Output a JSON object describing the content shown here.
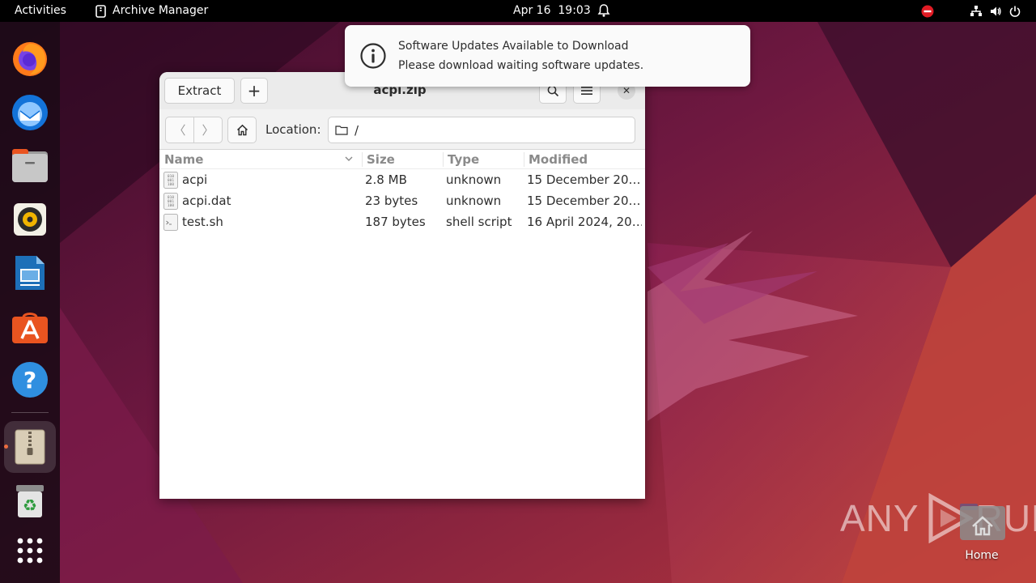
{
  "topbar": {
    "activities": "Activities",
    "app_name": "Archive Manager",
    "date": "Apr 16",
    "time": "19:03"
  },
  "dock": {
    "apps": [
      "firefox",
      "thunderbird",
      "files",
      "rhythmbox",
      "libreoffice-impress",
      "app-center",
      "help",
      "archive-manager",
      "trash",
      "show-apps"
    ]
  },
  "window": {
    "title": "acpi.zip",
    "extract_label": "Extract",
    "add_label": "+",
    "location_label": "Location:",
    "location_value": "/",
    "columns": {
      "name": "Name",
      "size": "Size",
      "type": "Type",
      "modified": "Modified"
    },
    "files": [
      {
        "icon": "binary-file-icon",
        "name": "acpi",
        "size": "2.8 MB",
        "type": "unknown",
        "modified": "15 December 20…"
      },
      {
        "icon": "binary-file-icon",
        "name": "acpi.dat",
        "size": "23 bytes",
        "type": "unknown",
        "modified": "15 December 20…"
      },
      {
        "icon": "script-file-icon",
        "name": "test.sh",
        "size": "187 bytes",
        "type": "shell script",
        "modified": "16 April 2024, 20…"
      }
    ]
  },
  "notification": {
    "title": "Software Updates Available to Download",
    "body": "Please download waiting software updates."
  },
  "desktop": {
    "home_label": "Home",
    "watermark_left": "ANY",
    "watermark_right": "RUN"
  },
  "colors": {
    "accent": "#e95420",
    "topbar": "#000000",
    "window_bg": "#ffffff",
    "headerbar": "#ebebeb"
  }
}
